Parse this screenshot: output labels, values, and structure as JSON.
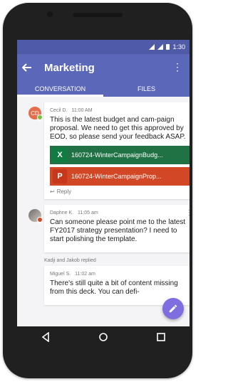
{
  "status": {
    "time": "1:30"
  },
  "header": {
    "title": "Marketing"
  },
  "tabs": [
    {
      "label": "CONVERSATION",
      "active": true
    },
    {
      "label": "FILES",
      "active": false
    }
  ],
  "messages": [
    {
      "author": "Cecil D.",
      "time": "11:00 AM",
      "avatar_initials": "CD",
      "text": "This is the latest budget and cam-paign proposal. We need to get this approved by EOD, so please send your feedback ASAP.",
      "attachments": [
        {
          "type": "excel",
          "label": "160724-WinterCampaignBudg...",
          "color": "#207245"
        },
        {
          "type": "ppt",
          "label": "160724-WinterCampaignProp...",
          "color": "#d24726"
        }
      ],
      "reply_label": "Reply"
    },
    {
      "author": "Daphne K.",
      "time": "11:05 am",
      "text": "Can someone please point me to the latest FY2017 strategy presentation? I need to start polishing the template.",
      "replied_note": "Kadji and Jakob replied"
    },
    {
      "author": "Miguel S.",
      "time": "11:02 am",
      "text": "There's still quite a bit of content missing from this deck. You can defi-"
    }
  ],
  "colors": {
    "accent": "#5b67b8",
    "statusbar": "#505ba8",
    "fab": "#7e6ee0"
  },
  "icons": {
    "back": "arrow-left",
    "menu": "vertical-ellipsis",
    "excel": "X",
    "ppt": "P",
    "reply": "reply-arrow",
    "fab": "pencil",
    "nav": [
      "back-triangle",
      "home-circle",
      "recents-square"
    ]
  }
}
